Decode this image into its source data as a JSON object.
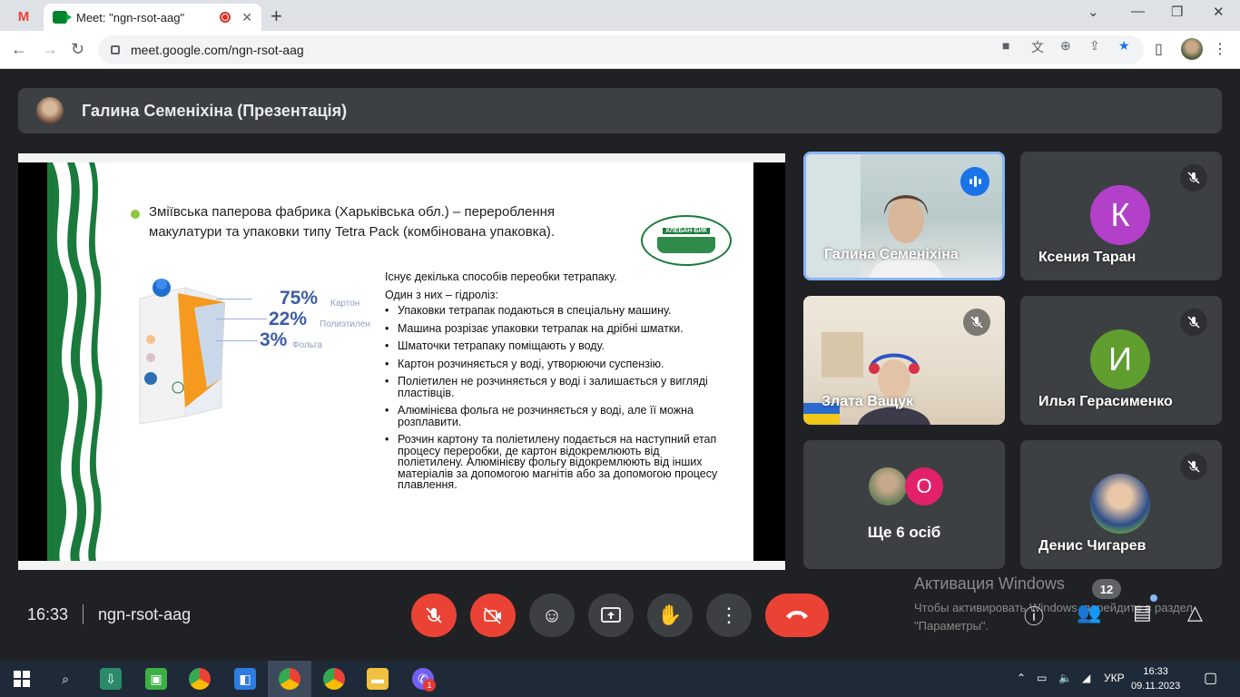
{
  "browser": {
    "tab_title": "Meet: \"ngn-rsot-aag\"",
    "url": "meet.google.com/ngn-rsot-aag"
  },
  "presenter": {
    "name": "Галина Семеніхіна (Презентація)"
  },
  "slide": {
    "title": "Зміївська паперова фабрика (Харьківська обл.) – перероблення макулатури та упаковки типу Tetra Pack (комбінована упаковка).",
    "logo_text": "ХЛЕБАН-БИК",
    "percentages": [
      {
        "value": "75%",
        "label": "Картон"
      },
      {
        "value": "22%",
        "label": "Полиэтилен"
      },
      {
        "value": "3%",
        "label": "Фольга"
      }
    ],
    "intro": [
      "Існує декілька способів переобки тетрапаку.",
      "Один з них – гідроліз:"
    ],
    "bullets": [
      "Упаковки тетрапак подаються в спеціальну машину.",
      "Машина розрізає упаковки тетрапак на дрібні шматки.",
      "Шматочки тетрапаку поміщають у воду.",
      "Картон розчиняється у воді, утворюючи суспензію.",
      "Поліетилен не розчиняється у воді і залишається у вигляді пластівців.",
      "Алюмінієва фольга не розчиняється у воді, але її можна розплавити.",
      "Розчин картону та поліетилену подається на наступний етап процесу переробки, де картон відокремлюють від поліетилену. Алюмінієву фольгу відокремлюють від інших матеріалів за допомогою магнітів або за допомогою процесу плавлення."
    ]
  },
  "participants": [
    {
      "name": "Галина Семеніхіна"
    },
    {
      "name": "Ксения Таран",
      "initial": "К",
      "color": "#b340c9"
    },
    {
      "name": "Злата Ващук"
    },
    {
      "name": "Илья Герасименко",
      "initial": "И",
      "color": "#5f9e2f"
    },
    {
      "name": "Ще 6 осіб",
      "initial": "О",
      "color": "#e2216a"
    },
    {
      "name": "Денис Чигарев"
    }
  ],
  "meeting": {
    "time": "16:33",
    "code": "ngn-rsot-aag",
    "people_count": "12"
  },
  "activation": {
    "title": "Активация Windows",
    "text": "Чтобы активировать Windows, перейдите в раздел \"Параметры\"."
  },
  "taskbar": {
    "lang": "УКР",
    "time": "16:33",
    "date": "09.11.2023",
    "viber_badge": "1"
  }
}
